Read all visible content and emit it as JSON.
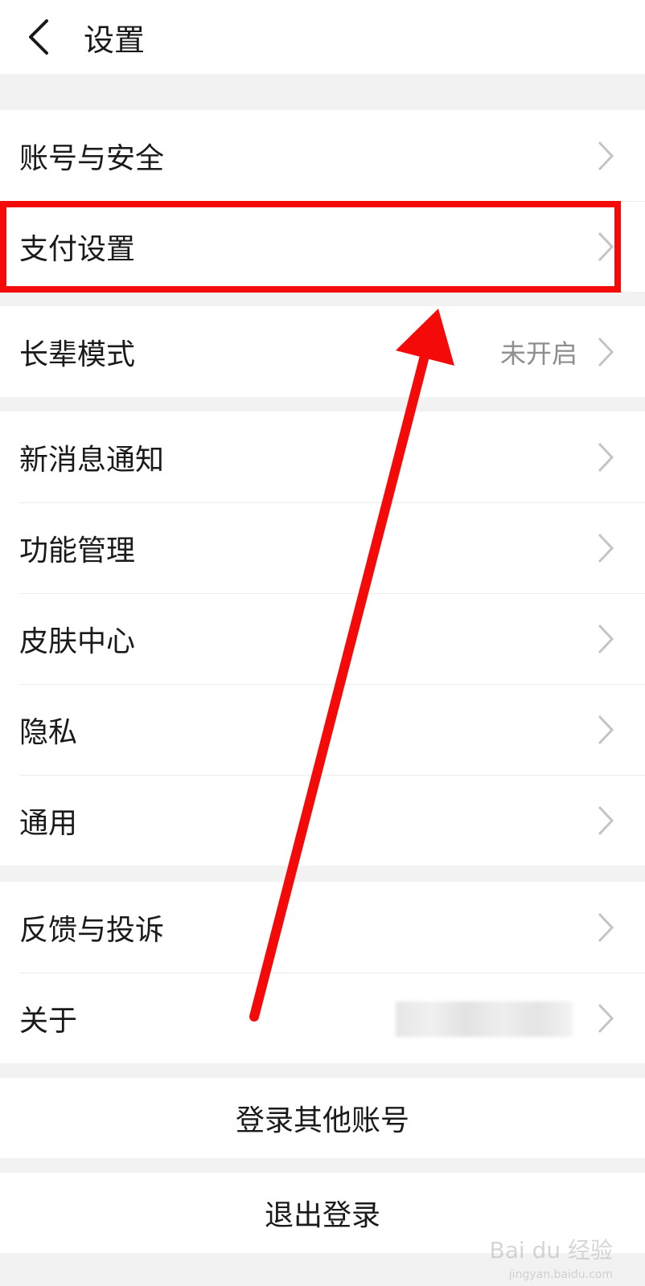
{
  "header": {
    "title": "设置",
    "back_icon": "chevron-left-icon"
  },
  "group1": {
    "items": [
      {
        "label": "账号与安全"
      },
      {
        "label": "支付设置"
      },
      {
        "label": "长辈模式",
        "value": "未开启"
      }
    ]
  },
  "group2": {
    "items": [
      {
        "label": "新消息通知"
      },
      {
        "label": "功能管理"
      },
      {
        "label": "皮肤中心"
      },
      {
        "label": "隐私"
      },
      {
        "label": "通用"
      }
    ]
  },
  "group3": {
    "items": [
      {
        "label": "反馈与投诉"
      },
      {
        "label": "关于"
      }
    ]
  },
  "actions": {
    "switch_account": "登录其他账号",
    "logout": "退出登录"
  },
  "annotation": {
    "highlight_color": "#f50a0a"
  },
  "watermark": {
    "text": "Bai du 经验",
    "sub": "jingyan.baidu.com"
  }
}
